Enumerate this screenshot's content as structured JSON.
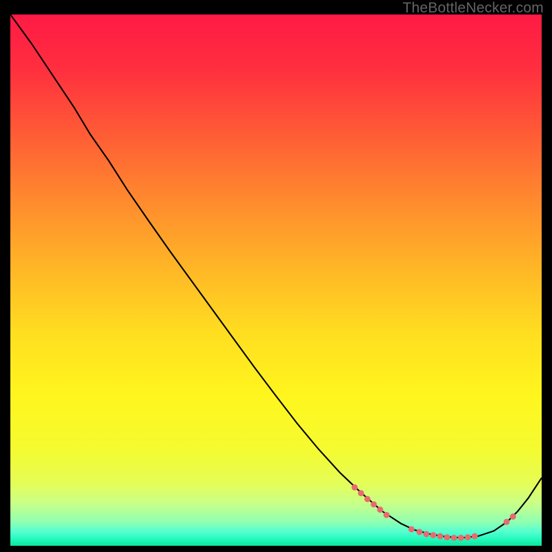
{
  "attribution": "TheBottleNecker.com",
  "gradient_stops": [
    {
      "offset": 0.0,
      "color": "#ff1a45"
    },
    {
      "offset": 0.1,
      "color": "#ff2e3f"
    },
    {
      "offset": 0.22,
      "color": "#ff5a36"
    },
    {
      "offset": 0.35,
      "color": "#ff8a2e"
    },
    {
      "offset": 0.48,
      "color": "#ffb726"
    },
    {
      "offset": 0.6,
      "color": "#ffde20"
    },
    {
      "offset": 0.72,
      "color": "#fff61e"
    },
    {
      "offset": 0.82,
      "color": "#f4fb30"
    },
    {
      "offset": 0.88,
      "color": "#e6fd55"
    },
    {
      "offset": 0.92,
      "color": "#c9ff87"
    },
    {
      "offset": 0.955,
      "color": "#90ffb2"
    },
    {
      "offset": 0.975,
      "color": "#4fffd0"
    },
    {
      "offset": 0.99,
      "color": "#1cf7b6"
    },
    {
      "offset": 1.0,
      "color": "#0ee49a"
    }
  ],
  "curve": {
    "stroke": "#000000",
    "width": 2.1,
    "points": [
      [
        0.0,
        0.0
      ],
      [
        0.04,
        0.055
      ],
      [
        0.08,
        0.115
      ],
      [
        0.12,
        0.175
      ],
      [
        0.15,
        0.225
      ],
      [
        0.185,
        0.275
      ],
      [
        0.22,
        0.33
      ],
      [
        0.26,
        0.388
      ],
      [
        0.3,
        0.445
      ],
      [
        0.34,
        0.5
      ],
      [
        0.38,
        0.555
      ],
      [
        0.42,
        0.61
      ],
      [
        0.46,
        0.665
      ],
      [
        0.5,
        0.718
      ],
      [
        0.54,
        0.77
      ],
      [
        0.58,
        0.818
      ],
      [
        0.62,
        0.862
      ],
      [
        0.66,
        0.9
      ],
      [
        0.7,
        0.935
      ],
      [
        0.735,
        0.958
      ],
      [
        0.76,
        0.97
      ],
      [
        0.79,
        0.978
      ],
      [
        0.82,
        0.983
      ],
      [
        0.85,
        0.985
      ],
      [
        0.88,
        0.982
      ],
      [
        0.91,
        0.972
      ],
      [
        0.935,
        0.955
      ],
      [
        0.955,
        0.935
      ],
      [
        0.975,
        0.91
      ],
      [
        1.0,
        0.872
      ]
    ]
  },
  "dots": {
    "fill": "#e86b6f",
    "radius": 5.8,
    "points": [
      [
        0.648,
        0.89
      ],
      [
        0.66,
        0.901
      ],
      [
        0.672,
        0.912
      ],
      [
        0.684,
        0.922
      ],
      [
        0.696,
        0.932
      ],
      [
        0.708,
        0.942
      ],
      [
        0.755,
        0.969
      ],
      [
        0.77,
        0.974
      ],
      [
        0.783,
        0.978
      ],
      [
        0.796,
        0.98
      ],
      [
        0.809,
        0.982
      ],
      [
        0.822,
        0.984
      ],
      [
        0.835,
        0.985
      ],
      [
        0.848,
        0.985
      ],
      [
        0.861,
        0.984
      ],
      [
        0.874,
        0.982
      ],
      [
        0.934,
        0.955
      ],
      [
        0.946,
        0.945
      ]
    ]
  },
  "chart_data": {
    "type": "line",
    "title": "",
    "xlabel": "",
    "ylabel": "",
    "xlim": [
      0,
      1
    ],
    "ylim": [
      0,
      1
    ],
    "note": "Axes are unlabeled in the source image; values are normalized plot coordinates (0–1 on each axis). The y-values below are 1 − image_y so that 1.0 is the top of the plot and 0.0 the bottom.",
    "series": [
      {
        "name": "curve",
        "x": [
          0.0,
          0.04,
          0.08,
          0.12,
          0.15,
          0.185,
          0.22,
          0.26,
          0.3,
          0.34,
          0.38,
          0.42,
          0.46,
          0.5,
          0.54,
          0.58,
          0.62,
          0.66,
          0.7,
          0.735,
          0.76,
          0.79,
          0.82,
          0.85,
          0.88,
          0.91,
          0.935,
          0.955,
          0.975,
          1.0
        ],
        "y": [
          1.0,
          0.945,
          0.885,
          0.825,
          0.775,
          0.725,
          0.67,
          0.612,
          0.555,
          0.5,
          0.445,
          0.39,
          0.335,
          0.282,
          0.23,
          0.182,
          0.138,
          0.1,
          0.065,
          0.042,
          0.03,
          0.022,
          0.017,
          0.015,
          0.018,
          0.028,
          0.045,
          0.065,
          0.09,
          0.128
        ]
      },
      {
        "name": "highlighted-points",
        "x": [
          0.648,
          0.66,
          0.672,
          0.684,
          0.696,
          0.708,
          0.755,
          0.77,
          0.783,
          0.796,
          0.809,
          0.822,
          0.835,
          0.848,
          0.861,
          0.874,
          0.934,
          0.946
        ],
        "y": [
          0.11,
          0.099,
          0.088,
          0.078,
          0.068,
          0.058,
          0.031,
          0.026,
          0.022,
          0.02,
          0.018,
          0.016,
          0.015,
          0.015,
          0.016,
          0.018,
          0.045,
          0.055
        ]
      }
    ],
    "background_gradient_stops": [
      {
        "offset": 0.0,
        "color": "#ff1a45"
      },
      {
        "offset": 0.48,
        "color": "#ffb726"
      },
      {
        "offset": 0.82,
        "color": "#f4fb30"
      },
      {
        "offset": 1.0,
        "color": "#0ee49a"
      }
    ]
  }
}
